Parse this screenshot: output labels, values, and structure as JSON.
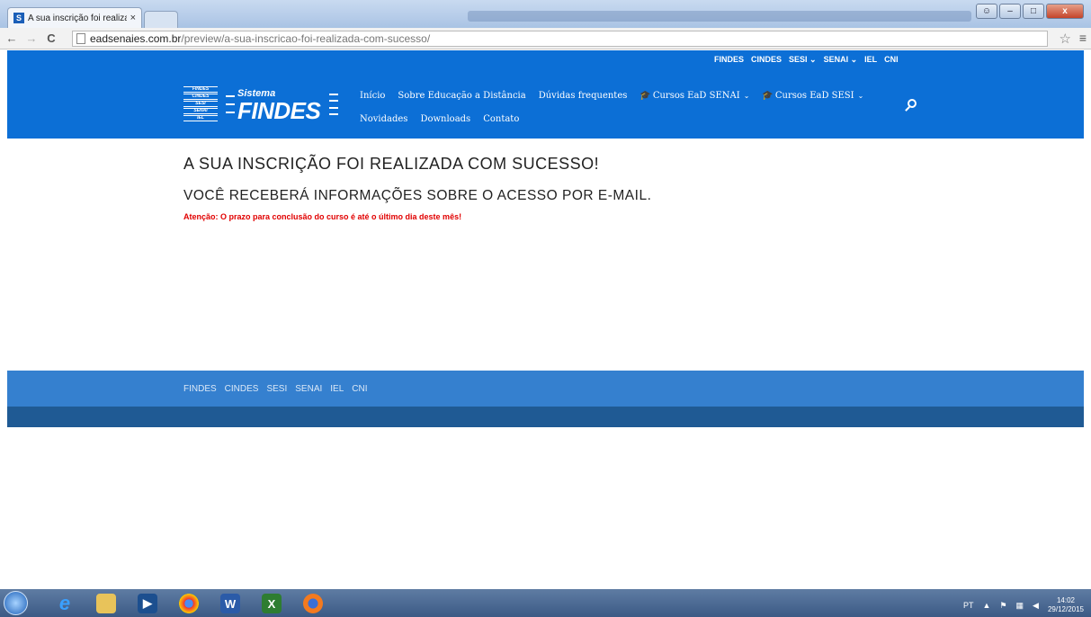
{
  "browser": {
    "tab_title": "A sua inscrição foi realizad",
    "tab_close": "×",
    "favicon": "S",
    "address_host": "eadsenaies.com.br",
    "address_path": "/preview/a-sua-inscricao-foi-realizada-com-sucesso/",
    "back": "←",
    "forward": "→",
    "reload": "C",
    "star": "☆",
    "menu": "≡",
    "min": "–",
    "max": "□",
    "close": "x"
  },
  "top_links": [
    {
      "label": "FINDES"
    },
    {
      "label": "CINDES"
    },
    {
      "label": "SESI ⌄"
    },
    {
      "label": "SENAI ⌄"
    },
    {
      "label": "IEL"
    },
    {
      "label": "CNI"
    }
  ],
  "logo": {
    "stack": [
      "FINDES",
      "CINDES",
      "SESI",
      "SENAI",
      "IEL",
      "IDEIES"
    ],
    "sistema": "Sistema",
    "findes": "FINDES"
  },
  "nav": {
    "row1": [
      {
        "label": "Início"
      },
      {
        "label": "Sobre Educação a Distância"
      },
      {
        "label": "Dúvidas frequentes"
      },
      {
        "label": "Cursos EaD SENAI"
      },
      {
        "label": "Cursos EaD SESI"
      }
    ],
    "row2": [
      {
        "label": "Novidades"
      },
      {
        "label": "Downloads"
      },
      {
        "label": "Contato"
      }
    ]
  },
  "content": {
    "title": "A SUA INSCRIÇÃO FOI REALIZADA COM SUCESSO!",
    "subtitle": "VOCÊ RECEBERÁ INFORMAÇÕES SOBRE O ACESSO POR E-MAIL.",
    "notice": "Atenção: O prazo para conclusão do curso é até o último dia deste mês!"
  },
  "footer_links": [
    "FINDES",
    "CINDES",
    "SESI",
    "SENAI",
    "IEL",
    "CNI"
  ],
  "taskbar": {
    "lang": "PT",
    "time": "14:02",
    "date": "29/12/2015"
  },
  "colors": {
    "header_blue": "#0c6fd6",
    "footer_blue": "#3580cf",
    "subfooter_blue": "#1f5a94",
    "notice_red": "#e10000"
  }
}
